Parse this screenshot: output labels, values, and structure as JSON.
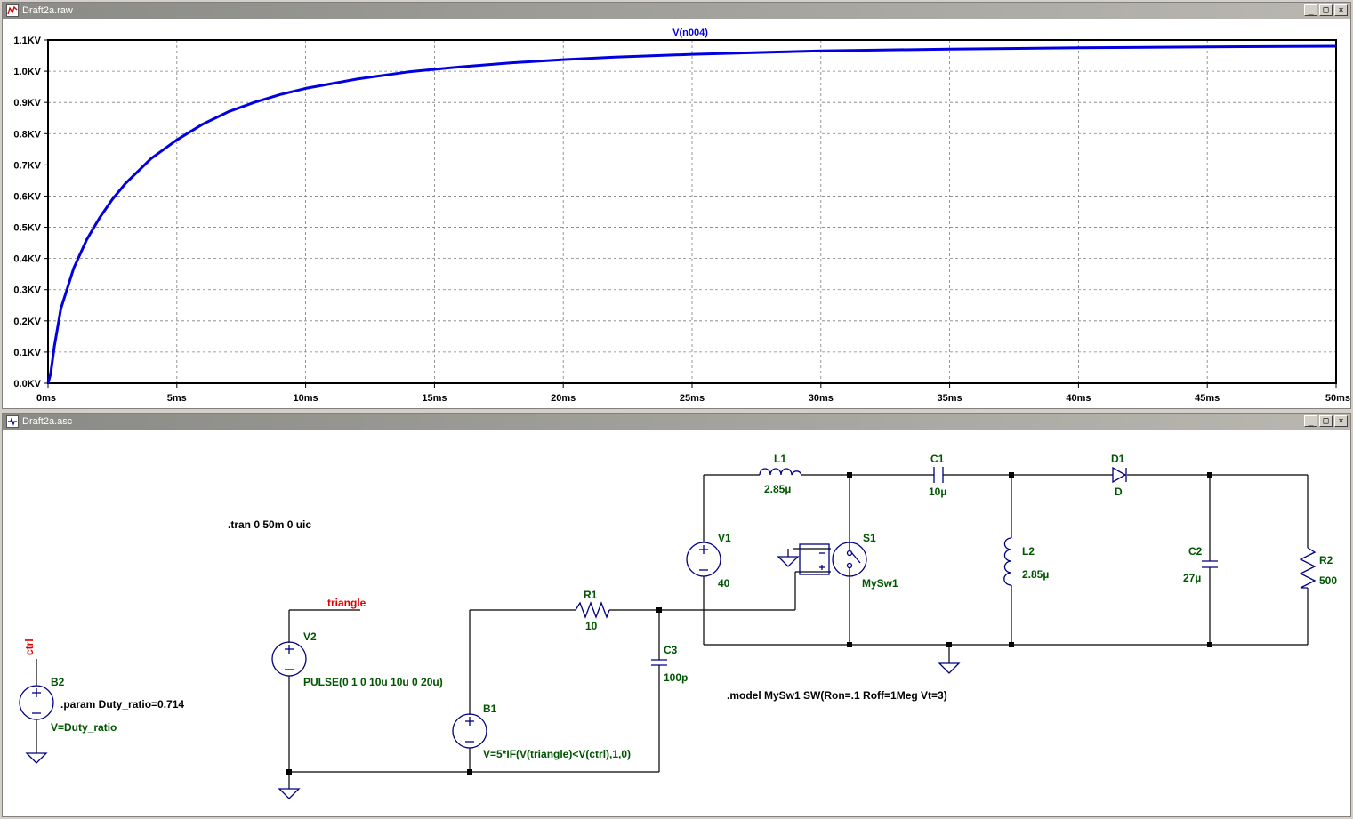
{
  "plot_window": {
    "title": "Draft2a.raw",
    "controls": [
      "_",
      "□",
      "×"
    ]
  },
  "schematic_window": {
    "title": "Draft2a.asc",
    "controls": [
      "_",
      "□",
      "×"
    ]
  },
  "chart_data": {
    "type": "line",
    "title": "V(n004)",
    "xlabel": "",
    "ylabel": "",
    "x_unit": "ms",
    "y_unit": "KV",
    "xlim": [
      0,
      50
    ],
    "ylim": [
      0,
      1.1
    ],
    "x_ticks": [
      "0ms",
      "5ms",
      "10ms",
      "15ms",
      "20ms",
      "25ms",
      "30ms",
      "35ms",
      "40ms",
      "45ms",
      "50ms"
    ],
    "y_ticks": [
      "0.0KV",
      "0.1KV",
      "0.2KV",
      "0.3KV",
      "0.4KV",
      "0.5KV",
      "0.6KV",
      "0.7KV",
      "0.8KV",
      "0.9KV",
      "1.0KV",
      "1.1KV"
    ],
    "grid": true,
    "series": [
      {
        "name": "V(n004)",
        "color": "#0000e0",
        "x": [
          0,
          0.1,
          0.25,
          0.5,
          1,
          1.5,
          2,
          2.5,
          3,
          4,
          5,
          6,
          7,
          8,
          9,
          10,
          12,
          14,
          16,
          18,
          20,
          22,
          25,
          28,
          30,
          35,
          40,
          45,
          50
        ],
        "y": [
          0,
          0.03,
          0.12,
          0.24,
          0.37,
          0.46,
          0.53,
          0.59,
          0.64,
          0.72,
          0.78,
          0.83,
          0.87,
          0.9,
          0.925,
          0.945,
          0.975,
          0.998,
          1.014,
          1.027,
          1.037,
          1.045,
          1.054,
          1.061,
          1.065,
          1.071,
          1.075,
          1.078,
          1.08
        ]
      }
    ]
  },
  "schematic": {
    "directives": {
      "tran": ".tran 0 50m 0 uic",
      "model": ".model MySw1  SW(Ron=.1 Roff=1Meg Vt=3)",
      "param": ".param Duty_ratio=0.714"
    },
    "net_labels": {
      "triangle": "triangle",
      "ctrl": "ctrl"
    },
    "components": {
      "L1": {
        "name": "L1",
        "value": "2.85µ"
      },
      "C1": {
        "name": "C1",
        "value": "10µ"
      },
      "D1": {
        "name": "D1",
        "value": "D"
      },
      "V1": {
        "name": "V1",
        "value": "40"
      },
      "S1": {
        "name": "S1",
        "value": "MySw1"
      },
      "L2": {
        "name": "L2",
        "value": "2.85µ"
      },
      "C2": {
        "name": "C2",
        "value": "27µ"
      },
      "R2": {
        "name": "R2",
        "value": "500"
      },
      "R1": {
        "name": "R1",
        "value": "10"
      },
      "C3": {
        "name": "C3",
        "value": "100p"
      },
      "V2": {
        "name": "V2",
        "value": "PULSE(0 1 0 10u 10u 0 20u)"
      },
      "B1": {
        "name": "B1",
        "value": "V=5*IF(V(triangle)<V(ctrl),1,0)"
      },
      "B2": {
        "name": "B2",
        "value": "V=Duty_ratio"
      }
    },
    "colors": {
      "wire": "#000000",
      "component": "#000080",
      "label": "#005500",
      "net_label": "#e00000"
    }
  }
}
